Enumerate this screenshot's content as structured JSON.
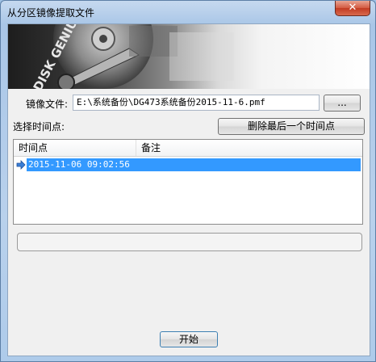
{
  "window": {
    "title": "从分区镜像提取文件",
    "close_symbol": "✕"
  },
  "banner": {
    "logo_text": "DISK GENIUS"
  },
  "image_file": {
    "label": "镜像文件:",
    "value": "E:\\系统备份\\DG473系统备份2015-11-6.pmf",
    "browse_label": "..."
  },
  "timepoints": {
    "label": "选择时间点:",
    "delete_last_label": "删除最后一个时间点",
    "columns": [
      "时间点",
      "备注"
    ],
    "rows": [
      {
        "time": "2015-11-06 09:02:56",
        "note": ""
      }
    ]
  },
  "progress": {
    "value": 0
  },
  "start_label": "开始"
}
